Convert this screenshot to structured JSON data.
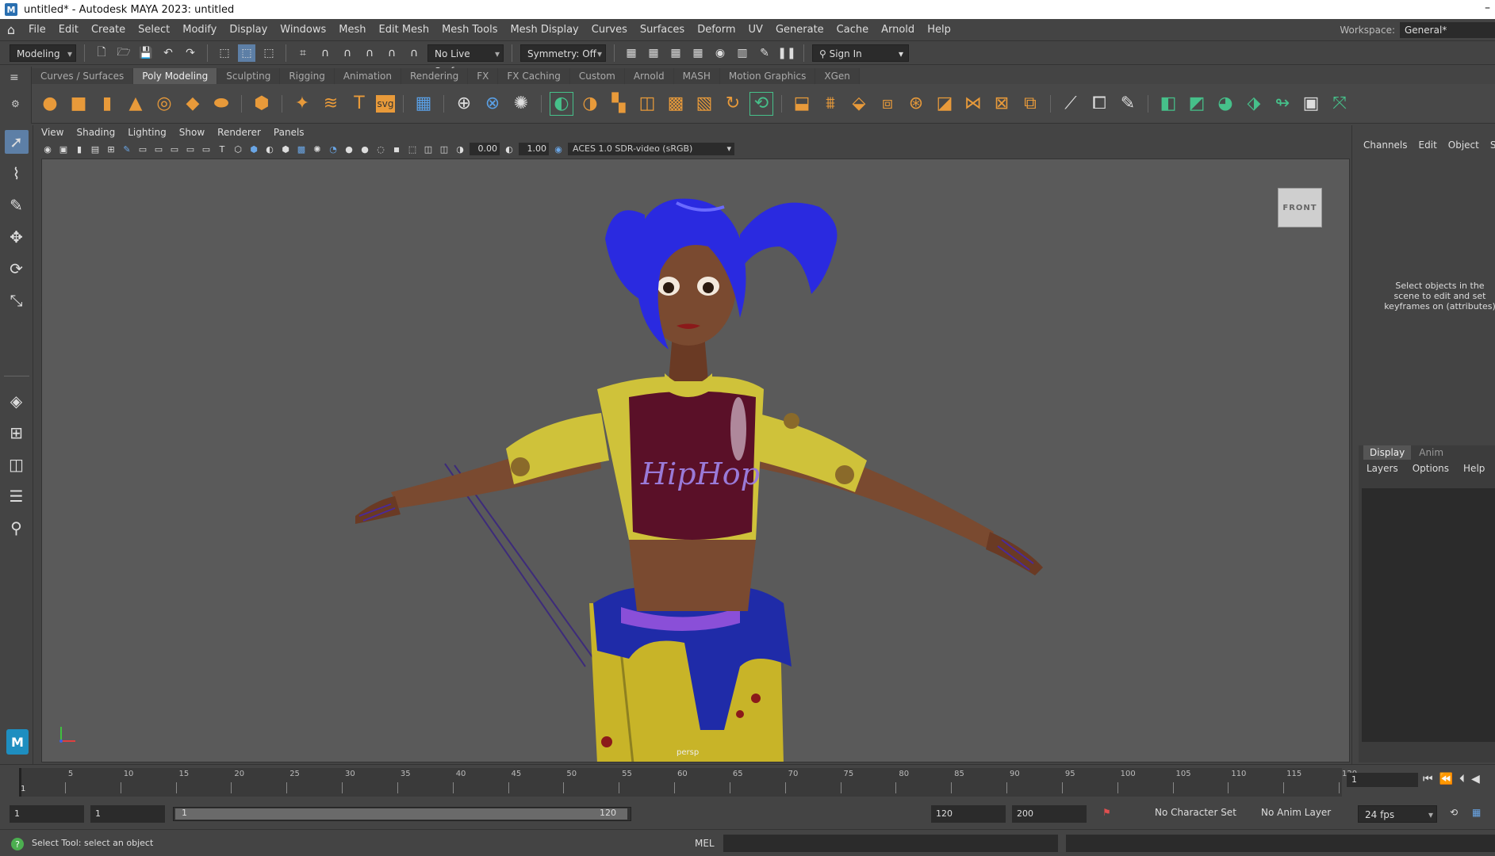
{
  "title": "untitled* - Autodesk MAYA 2023: untitled",
  "menus": [
    "File",
    "Edit",
    "Create",
    "Select",
    "Modify",
    "Display",
    "Windows",
    "Mesh",
    "Edit Mesh",
    "Mesh Tools",
    "Mesh Display",
    "Curves",
    "Surfaces",
    "Deform",
    "UV",
    "Generate",
    "Cache",
    "Arnold",
    "Help"
  ],
  "workspace": {
    "label": "Workspace:",
    "value": "General*"
  },
  "status_line": {
    "mode": "Modeling",
    "live_surface": "No Live Surface",
    "symmetry": "Symmetry: Off",
    "sign_in": "Sign In"
  },
  "shelf_tabs": [
    "Curves / Surfaces",
    "Poly Modeling",
    "Sculpting",
    "Rigging",
    "Animation",
    "Rendering",
    "FX",
    "FX Caching",
    "Custom",
    "Arnold",
    "MASH",
    "Motion Graphics",
    "XGen"
  ],
  "active_shelf_tab": "Poly Modeling",
  "panel_menu": [
    "View",
    "Shading",
    "Lighting",
    "Show",
    "Renderer",
    "Panels"
  ],
  "panel_fields": {
    "exposure": "0.00",
    "gamma": "1.00",
    "color_space": "ACES 1.0 SDR-video (sRGB)"
  },
  "viewport": {
    "view_cube": "FRONT",
    "camera": "persp",
    "print_text": "HipHop"
  },
  "channel_box": {
    "tabs": [
      "Channels",
      "Edit",
      "Object",
      "Sh"
    ],
    "message": "Select objects in the scene to edit and set keyframes on (attributes)"
  },
  "layer_editor": {
    "tabs": [
      "Display",
      "Anim"
    ],
    "menu": [
      "Layers",
      "Options",
      "Help"
    ]
  },
  "timeline": {
    "ticks": [
      "5",
      "10",
      "15",
      "20",
      "25",
      "30",
      "35",
      "40",
      "45",
      "50",
      "55",
      "60",
      "65",
      "70",
      "75",
      "80",
      "85",
      "90",
      "95",
      "100",
      "105",
      "110",
      "115",
      "120"
    ],
    "current_frame_label": "1",
    "current_frame_field": "1"
  },
  "range": {
    "start": "1",
    "playback_start": "1",
    "slider_start": "1",
    "slider_end": "120",
    "playback_end": "120",
    "end": "200",
    "character_set": "No Character Set",
    "anim_layer": "No Anim Layer",
    "fps": "24 fps"
  },
  "command_line": {
    "help_text": "Select Tool: select an object",
    "lang": "MEL"
  },
  "colors": {
    "accent": "#5d7fa6",
    "shelf_icon": "#e89a3a",
    "viewport_bg": "#5a5a5a"
  }
}
